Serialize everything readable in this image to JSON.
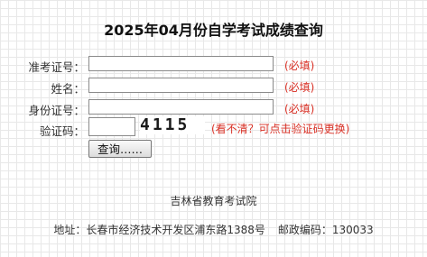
{
  "page": {
    "title": "2025年04月份自学考试成绩查询"
  },
  "form": {
    "fields": [
      {
        "label": "准考证号：",
        "value": "",
        "required": "(必填)"
      },
      {
        "label": "姓名：",
        "value": "",
        "required": "(必填)"
      },
      {
        "label": "身份证号：",
        "value": "",
        "required": "(必填)"
      }
    ],
    "captcha": {
      "label": "验证码：",
      "value": "",
      "image_text": "4115",
      "refresh_hint": "(看不清？可点击验证码更换)"
    },
    "submit_label": "查询……"
  },
  "footer": {
    "org": "吉林省教育考试院",
    "address": "地址：长春市经济技术开发区浦东路1388号",
    "postcode": "邮政编码：130033"
  },
  "colors": {
    "required": "#d93025",
    "grid": "#e8e8e8"
  }
}
